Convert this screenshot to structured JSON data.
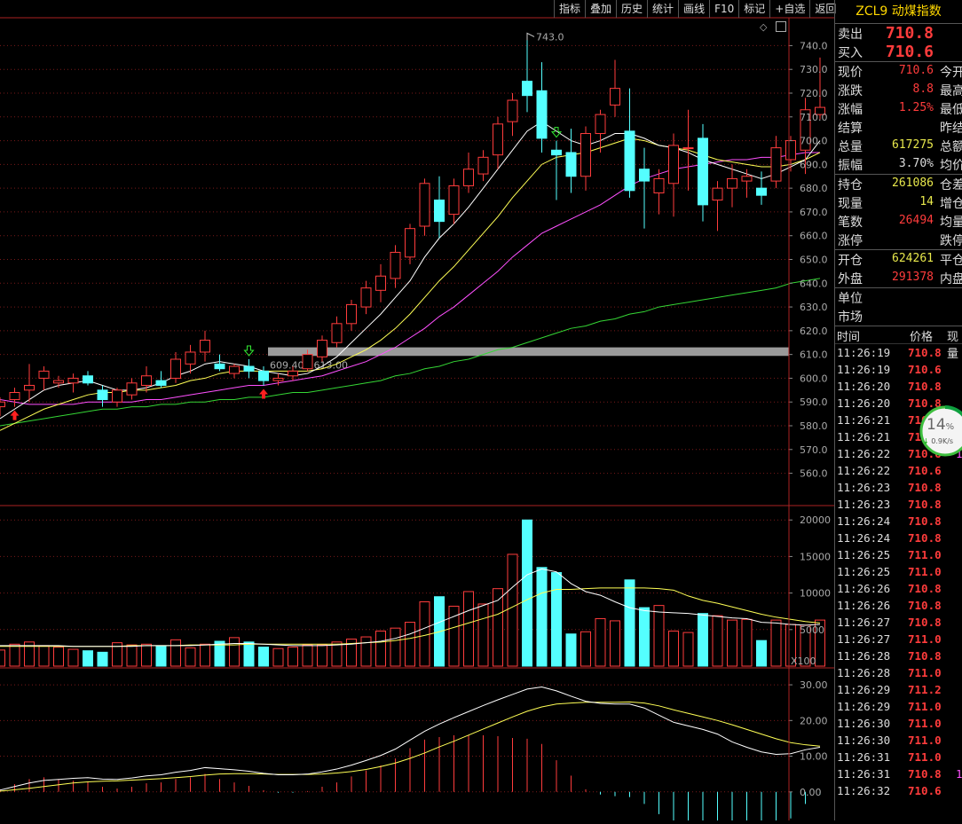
{
  "toolbar": {
    "buttons": [
      "指标",
      "叠加",
      "历史",
      "统计",
      "画线",
      "F10",
      "标记",
      "+自选",
      "返回"
    ]
  },
  "instrument": {
    "code": "ZCL9",
    "name": "动煤指数"
  },
  "quote": {
    "ask_label": "卖出",
    "ask": "710.8",
    "bid_label": "买入",
    "bid": "710.6",
    "rows1": [
      {
        "k": "现价",
        "v": "710.6",
        "c": "red",
        "k2": "今开"
      },
      {
        "k": "涨跌",
        "v": "8.8",
        "c": "red",
        "k2": "最高"
      },
      {
        "k": "涨幅",
        "v": "1.25%",
        "c": "red",
        "k2": "最低"
      },
      {
        "k": "结算",
        "v": "",
        "c": "wht",
        "k2": "昨结"
      },
      {
        "k": "总量",
        "v": "617275",
        "c": "yel",
        "k2": "总额"
      },
      {
        "k": "振幅",
        "v": "3.70%",
        "c": "wht",
        "k2": "均价"
      }
    ],
    "rows2": [
      {
        "k": "持仓",
        "v": "261086",
        "c": "yel",
        "k2": "仓差"
      },
      {
        "k": "现量",
        "v": "14",
        "c": "yel",
        "k2": "增仓"
      },
      {
        "k": "笔数",
        "v": "26494",
        "c": "red",
        "k2": "均量"
      },
      {
        "k": "涨停",
        "v": "",
        "c": "wht",
        "k2": "跌停"
      }
    ],
    "rows3": [
      {
        "k": "开仓",
        "v": "624261",
        "c": "yel",
        "k2": "平仓"
      },
      {
        "k": "外盘",
        "v": "291378",
        "c": "red",
        "k2": "内盘"
      }
    ],
    "rows4": [
      {
        "k": "单位",
        "v": "",
        "c": "wht",
        "k2": ""
      },
      {
        "k": "市场",
        "v": "",
        "c": "wht",
        "k2": ""
      }
    ]
  },
  "ticks_header": {
    "time": "时间",
    "price": "价格",
    "vol": "现量"
  },
  "ticks": [
    {
      "t": "11:26:19",
      "p": "710.8",
      "v": ""
    },
    {
      "t": "11:26:19",
      "p": "710.6",
      "v": ""
    },
    {
      "t": "11:26:20",
      "p": "710.8",
      "v": ""
    },
    {
      "t": "11:26:20",
      "p": "710.8",
      "v": ""
    },
    {
      "t": "11:26:21",
      "p": "710.8",
      "v": ""
    },
    {
      "t": "11:26:21",
      "p": "710.8",
      "v": ""
    },
    {
      "t": "11:26:22",
      "p": "710.6",
      "v": "1"
    },
    {
      "t": "11:26:22",
      "p": "710.6",
      "v": ""
    },
    {
      "t": "11:26:23",
      "p": "710.8",
      "v": ""
    },
    {
      "t": "11:26:23",
      "p": "710.8",
      "v": ""
    },
    {
      "t": "11:26:24",
      "p": "710.8",
      "v": ""
    },
    {
      "t": "11:26:24",
      "p": "710.8",
      "v": ""
    },
    {
      "t": "11:26:25",
      "p": "711.0",
      "v": ""
    },
    {
      "t": "11:26:25",
      "p": "711.0",
      "v": ""
    },
    {
      "t": "11:26:26",
      "p": "710.8",
      "v": ""
    },
    {
      "t": "11:26:26",
      "p": "710.8",
      "v": ""
    },
    {
      "t": "11:26:27",
      "p": "710.8",
      "v": ""
    },
    {
      "t": "11:26:27",
      "p": "711.0",
      "v": ""
    },
    {
      "t": "11:26:28",
      "p": "710.8",
      "v": ""
    },
    {
      "t": "11:26:28",
      "p": "711.0",
      "v": ""
    },
    {
      "t": "11:26:29",
      "p": "711.2",
      "v": ""
    },
    {
      "t": "11:26:29",
      "p": "711.0",
      "v": ""
    },
    {
      "t": "11:26:30",
      "p": "711.0",
      "v": ""
    },
    {
      "t": "11:26:30",
      "p": "711.0",
      "v": ""
    },
    {
      "t": "11:26:31",
      "p": "711.0",
      "v": ""
    },
    {
      "t": "11:26:31",
      "p": "710.8",
      "v": "1"
    },
    {
      "t": "11:26:32",
      "p": "710.6",
      "v": ""
    }
  ],
  "speed_badge": {
    "percent": "14",
    "unit": "%",
    "rate": "0.9K/s"
  },
  "chart_data": [
    {
      "type": "candlestick",
      "ylim": [
        552,
        748
      ],
      "yticks": [
        "740.0",
        "730.0",
        "720.0",
        "710.0",
        "700.0",
        "690.0",
        "680.0",
        "670.0",
        "660.0",
        "650.0",
        "640.0",
        "630.0",
        "620.0",
        "610.0",
        "600.0",
        "590.0",
        "580.0",
        "570.0",
        "560.0"
      ],
      "high_label": "743.0",
      "band_label": "609.40 - 613.00",
      "band_range": [
        609.4,
        613.0
      ],
      "candles": [
        [
          588,
          592,
          584,
          590
        ],
        [
          591,
          596,
          588,
          594
        ],
        [
          595,
          606,
          590,
          597
        ],
        [
          600,
          605,
          595,
          603
        ],
        [
          598,
          601,
          596,
          599
        ],
        [
          598,
          602,
          594,
          600
        ],
        [
          601,
          603,
          597,
          598
        ],
        [
          595,
          597,
          588,
          591
        ],
        [
          590,
          596,
          588,
          595
        ],
        [
          593,
          600,
          591,
          598
        ],
        [
          597,
          605,
          594,
          601
        ],
        [
          599,
          603,
          596,
          597
        ],
        [
          600,
          611,
          598,
          608
        ],
        [
          606,
          614,
          602,
          611
        ],
        [
          611,
          620,
          607,
          616
        ],
        [
          606,
          610,
          603,
          604
        ],
        [
          602,
          606,
          600,
          605
        ],
        [
          605,
          608,
          600,
          603
        ],
        [
          603,
          605,
          597,
          599
        ],
        [
          599,
          602,
          597,
          600
        ],
        [
          601,
          605,
          599,
          603
        ],
        [
          604,
          612,
          603,
          610
        ],
        [
          609,
          618,
          607,
          616
        ],
        [
          615,
          626,
          613,
          623
        ],
        [
          623,
          633,
          620,
          631
        ],
        [
          630,
          641,
          627,
          638
        ],
        [
          637,
          648,
          632,
          643
        ],
        [
          642,
          656,
          638,
          653
        ],
        [
          651,
          665,
          648,
          663
        ],
        [
          664,
          684,
          660,
          682
        ],
        [
          675,
          685,
          659,
          666
        ],
        [
          669,
          684,
          665,
          681
        ],
        [
          681,
          695,
          678,
          688
        ],
        [
          686,
          696,
          683,
          693
        ],
        [
          694,
          710,
          688,
          707
        ],
        [
          708,
          720,
          702,
          717
        ],
        [
          725,
          743,
          712,
          719
        ],
        [
          721,
          733,
          695,
          701
        ],
        [
          696,
          700,
          675,
          694
        ],
        [
          695,
          705,
          678,
          685
        ],
        [
          685,
          706,
          679,
          703
        ],
        [
          703,
          713,
          695,
          711
        ],
        [
          715,
          734,
          710,
          722
        ],
        [
          704,
          722,
          676,
          679
        ],
        [
          688,
          697,
          663,
          683
        ],
        [
          678,
          688,
          669,
          684
        ],
        [
          682,
          703,
          668,
          698
        ],
        [
          697,
          713,
          679,
          697
        ],
        [
          701,
          707,
          666,
          673
        ],
        [
          675,
          683,
          662,
          680
        ],
        [
          680,
          690,
          672,
          684
        ],
        [
          683,
          688,
          676,
          685
        ],
        [
          680,
          687,
          673,
          677
        ],
        [
          683,
          702,
          680,
          697
        ],
        [
          692,
          702,
          687,
          700
        ],
        [
          696,
          718,
          686,
          713
        ],
        [
          711,
          735,
          709,
          714
        ]
      ],
      "ma_white": [
        583,
        587,
        591,
        595,
        597,
        598,
        599,
        597,
        595,
        595,
        596,
        598,
        601,
        603,
        606,
        607,
        606,
        605,
        603,
        602,
        601,
        602,
        605,
        609,
        615,
        621,
        627,
        634,
        641,
        651,
        659,
        665,
        672,
        680,
        688,
        696,
        704,
        708,
        704,
        700,
        698,
        700,
        703,
        703,
        701,
        698,
        697,
        695,
        692,
        690,
        688,
        686,
        684,
        686,
        689,
        692,
        700
      ],
      "ma_yellow": [
        578,
        581,
        584,
        587,
        589,
        591,
        593,
        594,
        594,
        595,
        595,
        596,
        597,
        599,
        600,
        602,
        603,
        603,
        603,
        603,
        603,
        603,
        604,
        606,
        609,
        612,
        616,
        621,
        627,
        634,
        641,
        647,
        654,
        661,
        668,
        676,
        683,
        690,
        693,
        694,
        695,
        697,
        699,
        701,
        700,
        698,
        697,
        696,
        694,
        692,
        691,
        690,
        689,
        689,
        690,
        692,
        695
      ],
      "ma_magenta": [
        591,
        590,
        589,
        589,
        589,
        589,
        590,
        590,
        590,
        590,
        591,
        591,
        592,
        593,
        594,
        595,
        596,
        597,
        597,
        598,
        599,
        600,
        601,
        603,
        605,
        607,
        610,
        613,
        617,
        621,
        626,
        630,
        635,
        640,
        645,
        651,
        656,
        661,
        664,
        667,
        670,
        673,
        677,
        681,
        684,
        686,
        688,
        689,
        690,
        691,
        692,
        692,
        693,
        693,
        694,
        695,
        695
      ],
      "ma_green": [
        580,
        581,
        582,
        583,
        584,
        585,
        586,
        587,
        587,
        588,
        588,
        589,
        589,
        590,
        590,
        591,
        591,
        592,
        592,
        593,
        594,
        594,
        595,
        596,
        597,
        598,
        599,
        601,
        602,
        604,
        605,
        607,
        608,
        610,
        612,
        613,
        615,
        617,
        619,
        621,
        622,
        624,
        625,
        627,
        628,
        630,
        631,
        632,
        633,
        634,
        635,
        636,
        637,
        638,
        640,
        641,
        642
      ]
    },
    {
      "type": "bar",
      "ylim": [
        0,
        21000
      ],
      "yticks": [
        "20000",
        "15000",
        "10000",
        "5000"
      ],
      "unit": "X100",
      "values": [
        2200,
        3000,
        3300,
        2800,
        2600,
        2300,
        2100,
        1900,
        3200,
        2900,
        3000,
        2700,
        3600,
        2500,
        3000,
        3400,
        3900,
        3300,
        2600,
        2400,
        2600,
        2900,
        2900,
        3300,
        3700,
        4000,
        4800,
        5200,
        6000,
        8800,
        9500,
        8200,
        10200,
        8500,
        10600,
        15300,
        20000,
        13500,
        12800,
        4400,
        4700,
        6500,
        6200,
        11800,
        8000,
        8300,
        4800,
        4600,
        7200,
        6900,
        6300,
        6400,
        3500,
        6300,
        5700,
        5600,
        6300
      ],
      "ma_white": [
        2800,
        2800,
        2800,
        2800,
        2800,
        2700,
        2700,
        2700,
        2700,
        2700,
        2800,
        2800,
        2800,
        2800,
        2900,
        3000,
        3100,
        3100,
        3000,
        2900,
        2800,
        2800,
        2800,
        2900,
        3000,
        3200,
        3400,
        3800,
        4400,
        5200,
        6000,
        6800,
        7600,
        8300,
        9000,
        10800,
        12500,
        13300,
        12900,
        11300,
        10200,
        9700,
        8800,
        8000,
        7600,
        7400,
        7300,
        7200,
        7000,
        6800,
        6600,
        6500,
        6000,
        5900,
        5700,
        5600,
        5700
      ],
      "ma_yellow": [
        2700,
        2700,
        2700,
        2700,
        2700,
        2700,
        2700,
        2700,
        2700,
        2800,
        2800,
        2800,
        2800,
        2900,
        2900,
        2900,
        2900,
        3000,
        3000,
        3000,
        3000,
        3000,
        3000,
        3000,
        3100,
        3200,
        3300,
        3500,
        3800,
        4200,
        4700,
        5300,
        5900,
        6500,
        7100,
        8100,
        9100,
        10000,
        10500,
        10500,
        10600,
        10700,
        10700,
        10700,
        10700,
        10600,
        10400,
        9600,
        9000,
        8600,
        8100,
        7600,
        7100,
        6700,
        6400,
        6100,
        5900
      ]
    },
    {
      "type": "macd",
      "ylim": [
        -8,
        33
      ],
      "yticks": [
        "30.00",
        "20.00",
        "10.00",
        "0.00"
      ],
      "dif": [
        0.5,
        1.5,
        2.5,
        3.2,
        3.5,
        3.8,
        4,
        3.6,
        3.5,
        3.9,
        4.5,
        4.8,
        5.5,
        6,
        6.8,
        6.5,
        6.2,
        5.8,
        5.2,
        4.8,
        4.8,
        5,
        5.6,
        6.4,
        7.5,
        8.8,
        10.2,
        12,
        14.5,
        17,
        19,
        20.8,
        22.5,
        24.2,
        25.8,
        27.3,
        28.8,
        29.4,
        28.3,
        26.8,
        25.4,
        24.8,
        24.6,
        24.6,
        23.5,
        21.5,
        19.5,
        18.5,
        17.5,
        16.2,
        14,
        12.5,
        11.2,
        10.5,
        10.7,
        11.8,
        12.5
      ],
      "dea": [
        0.2,
        0.6,
        1,
        1.5,
        2,
        2.5,
        2.8,
        3,
        3.1,
        3.3,
        3.5,
        3.7,
        4,
        4.3,
        4.7,
        5,
        5.1,
        5.1,
        5,
        4.9,
        4.9,
        4.9,
        5,
        5.3,
        5.7,
        6.3,
        7.1,
        8.1,
        9.4,
        10.9,
        12.6,
        14.2,
        15.9,
        17.6,
        19.3,
        21,
        22.6,
        23.8,
        24.6,
        24.9,
        25.1,
        25.1,
        25.1,
        25.2,
        24.9,
        24.1,
        23,
        22,
        21,
        20,
        18.8,
        17.5,
        16.2,
        14.9,
        13.8,
        13.2,
        12.8
      ],
      "hist": [
        0.3,
        0.9,
        1.5,
        1.7,
        1.5,
        1.3,
        1.2,
        0.6,
        0.4,
        0.6,
        1,
        1.1,
        1.5,
        1.7,
        2.1,
        1.5,
        1.1,
        0.7,
        0.2,
        -0.1,
        -0.1,
        0.1,
        0.6,
        1.1,
        1.8,
        2.5,
        3.1,
        3.9,
        5.1,
        6.1,
        6.4,
        6.6,
        6.6,
        6.6,
        6.5,
        6.3,
        6.2,
        5.6,
        3.7,
        1.9,
        0.3,
        -0.3,
        -0.5,
        -0.6,
        -1.4,
        -2.6,
        -3.5,
        -3.5,
        -3.5,
        -3.8,
        -4.8,
        -5,
        -5,
        -4.4,
        -3.1,
        -1.4,
        -0.3
      ]
    }
  ],
  "colors": {
    "up": "#ff3c3c",
    "down": "#54ffff",
    "ma_white": "#ffffff",
    "ma_yellow": "#ffff55",
    "ma_magenta": "#ff50ff",
    "ma_green": "#35d635",
    "grid": "#7a1a1a",
    "band": "#9a9a9a"
  }
}
